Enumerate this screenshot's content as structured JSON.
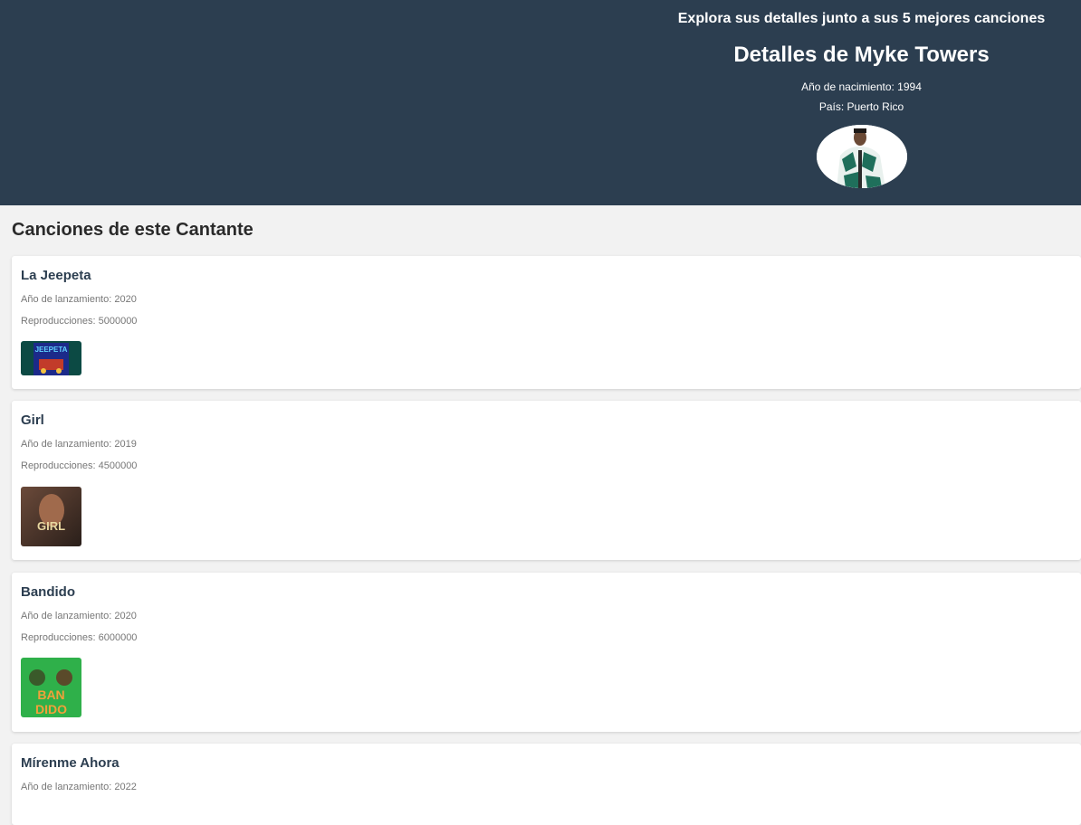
{
  "header": {
    "tagline": "Explora sus detalles junto a sus 5 mejores canciones",
    "title": "Detalles de Myke Towers",
    "birth_year": "Año de nacimiento: 1994",
    "country": "País: Puerto Rico",
    "colors": {
      "background": "#2c3e50",
      "text": "#ffffff"
    }
  },
  "section": {
    "title": "Canciones de este Cantante"
  },
  "songs": [
    {
      "title": "La Jeepeta",
      "year": "Año de lanzamiento: 2020",
      "plays": "Reproducciones: 5000000",
      "cover_text": "JEEPETA"
    },
    {
      "title": "Girl",
      "year": "Año de lanzamiento: 2019",
      "plays": "Reproducciones: 4500000",
      "cover_text": "GIRL"
    },
    {
      "title": "Bandido",
      "year": "Año de lanzamiento: 2020",
      "plays": "Reproducciones: 6000000",
      "cover_text_1": "BAN",
      "cover_text_2": "DIDO"
    },
    {
      "title": "Mírenme Ahora",
      "year": "Año de lanzamiento: 2022"
    }
  ]
}
